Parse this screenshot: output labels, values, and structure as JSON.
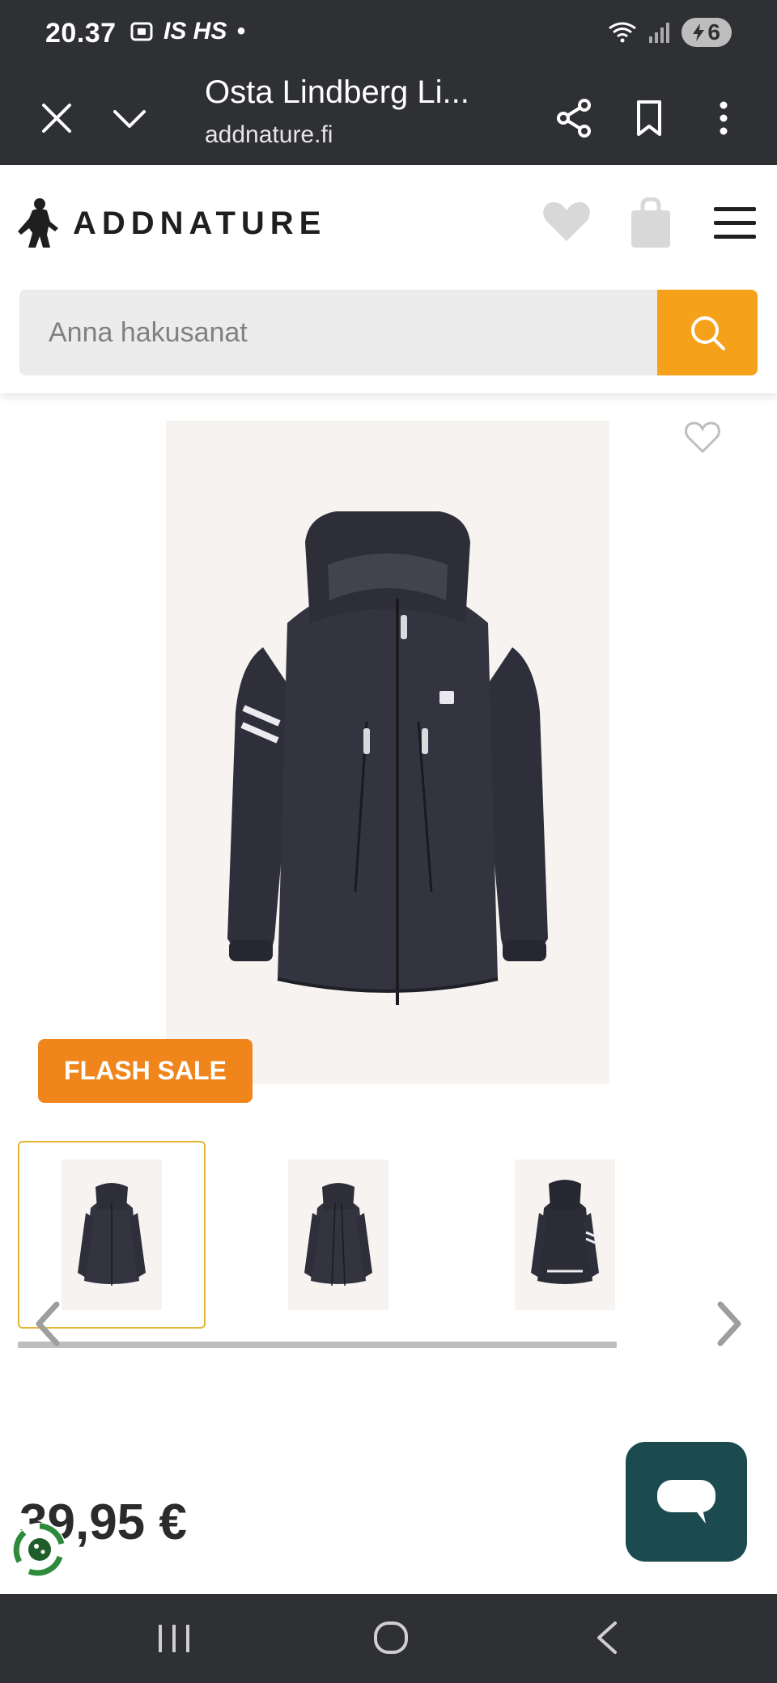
{
  "status_bar": {
    "time": "20.37",
    "left_icons": "IS HS",
    "dot": "•",
    "battery": "6"
  },
  "browser": {
    "page_title": "Osta Lindberg Li...",
    "url": "addnature.fi"
  },
  "header": {
    "logo_text": "ADDNATURE",
    "search": {
      "placeholder": "Anna hakusanat",
      "value": ""
    },
    "accent_color": "#f6a11a"
  },
  "product": {
    "badge": "FLASH SALE",
    "badge_color": "#f0851c",
    "price": "39,95 €",
    "thumbnails": [
      {
        "view": "front",
        "active": true
      },
      {
        "view": "front-open",
        "active": false
      },
      {
        "view": "back",
        "active": false
      }
    ]
  },
  "chat": {
    "color": "#1b4b4f"
  },
  "icons": {
    "close": "close-icon",
    "collapse": "chevron-down-icon",
    "share": "share-icon",
    "bookmark": "bookmark-icon",
    "more": "more-vertical-icon",
    "wishlist": "heart-icon",
    "cart": "shopping-bag-icon",
    "menu": "hamburger-menu-icon",
    "search": "search-icon",
    "chat": "chat-bubble-icon"
  }
}
